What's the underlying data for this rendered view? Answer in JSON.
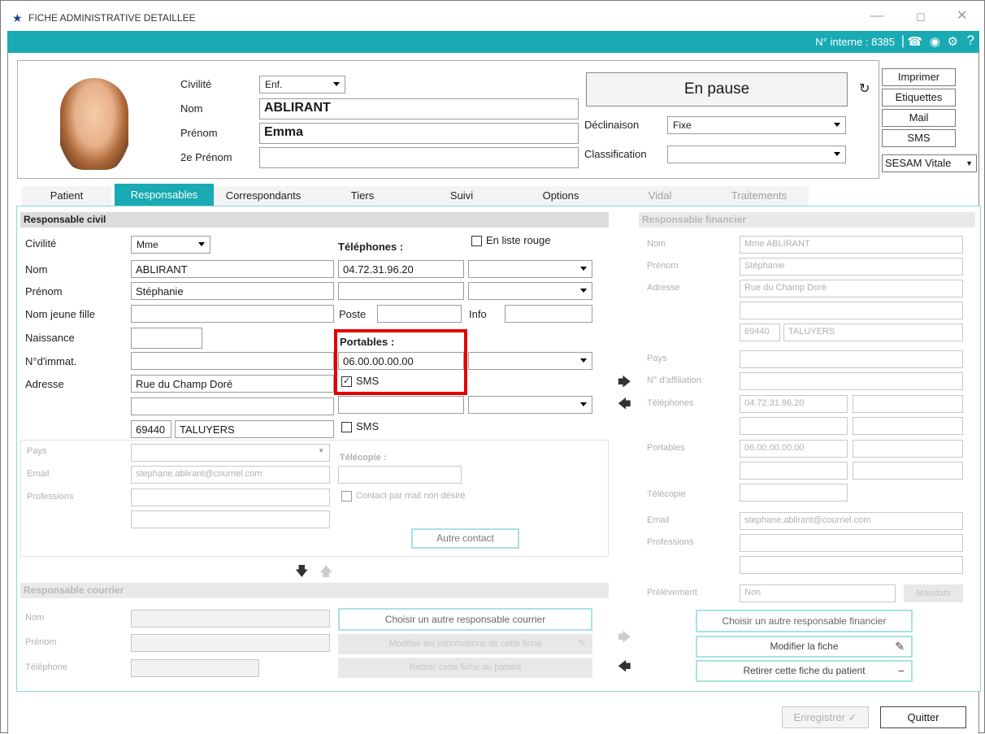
{
  "window": {
    "title": "FICHE ADMINISTRATIVE DETAILLEE",
    "minimize": "—",
    "maximize": "☐",
    "close": "✕"
  },
  "toolbar": {
    "n_interne": "N° interne : 8385",
    "separator": "|"
  },
  "identity": {
    "civilite_label": "Civilité",
    "civilite_value": "Enf.",
    "nom_label": "Nom",
    "nom_value": "ABLIRANT",
    "prenom_label": "Prénom",
    "prenom_value": "Emma",
    "prenom2_label": "2e Prénom",
    "prenom2_value": "",
    "status": "En pause",
    "declinaison_label": "Déclinaison",
    "declinaison_value": "Fixe",
    "classification_label": "Classification",
    "classification_value": ""
  },
  "side_buttons": {
    "imprimer": "Imprimer",
    "etiquettes": "Etiquettes",
    "mail": "Mail",
    "sms": "SMS",
    "sesam": "SESAM Vitale"
  },
  "tabs": [
    {
      "label": "Patient"
    },
    {
      "label": "Responsables"
    },
    {
      "label": "Correspondants"
    },
    {
      "label": "Tiers"
    },
    {
      "label": "Suivi"
    },
    {
      "label": "Options"
    },
    {
      "label": "Vidal"
    },
    {
      "label": "Traitements"
    }
  ],
  "resp_civil": {
    "title": "Responsable civil",
    "civilite_label": "Civilité",
    "civilite_value": "Mme",
    "nom_label": "Nom",
    "nom_value": "ABLIRANT",
    "prenom_label": "Prénom",
    "prenom_value": "Stéphanie",
    "nomjf_label": "Nom jeune fille",
    "nomjf_value": "",
    "naissance_label": "Naissance",
    "naissance_value": "",
    "immat_label": "N°d'immat.",
    "immat_value": "",
    "adresse_label": "Adresse",
    "adresse1": "Rue du Champ Doré",
    "adresse2": "",
    "cp": "69440",
    "ville": "TALUYERS",
    "telephones_label": "Téléphones :",
    "liste_rouge": "En liste rouge",
    "tel1": "04.72.31.96.20",
    "tel2": "",
    "poste_label": "Poste",
    "poste_value": "",
    "info_label": "Info",
    "info_value": "",
    "portables_label": "Portables :",
    "portable1": "06.00.00.00.00",
    "sms1": "SMS",
    "portable2": "",
    "sms2": "SMS",
    "pays_label": "Pays",
    "pays_value": "",
    "email_label": "Email",
    "email_value": "stephane.ablirant@courriel.com",
    "professions_label": "Professions",
    "telecopie_label": "Télécopie :",
    "telecopie_value": "",
    "contact_mail": "Contact par mail non désiré",
    "autre_contact": "Autre contact"
  },
  "resp_courrier": {
    "title": "Responsable courrier",
    "nom_label": "Nom",
    "prenom_label": "Prénom",
    "telephone_label": "Téléphone",
    "btn_choisir": "Choisir un autre responsable courrier",
    "btn_modifier": "Modifier les informations de cette fiche",
    "btn_retirer": "Retirer cette fiche du patient"
  },
  "resp_financier": {
    "title": "Responsable financier",
    "nom_label": "Nom",
    "nom_value": "Mme ABLIRANT",
    "prenom_label": "Prénom",
    "prenom_value": "Stéphanie",
    "adresse_label": "Adresse",
    "adresse_value": "Rue du Champ Doré",
    "cp": "69440",
    "ville": "TALUYERS",
    "pays_label": "Pays",
    "affiliation_label": "N° d'affiliation",
    "telephones_label": "Téléphones",
    "telephone_value": "04.72.31.96.20",
    "portables_label": "Portables",
    "portable_value": "06.00.00.00.00",
    "telecopie_label": "Télécopie",
    "email_label": "Email",
    "email_value": "stephane.ablirant@courriel.com",
    "professions_label": "Professions",
    "prelevement_label": "Prélèvement",
    "prelevement_value": "Non",
    "mandats": "Mandats",
    "btn_choisir": "Choisir un autre responsable financier",
    "btn_modifier": "Modifier la fiche",
    "btn_retirer": "Retirer cette fiche du patient"
  },
  "footer": {
    "enregistrer": "Enregistrer",
    "quitter": "Quitter"
  }
}
